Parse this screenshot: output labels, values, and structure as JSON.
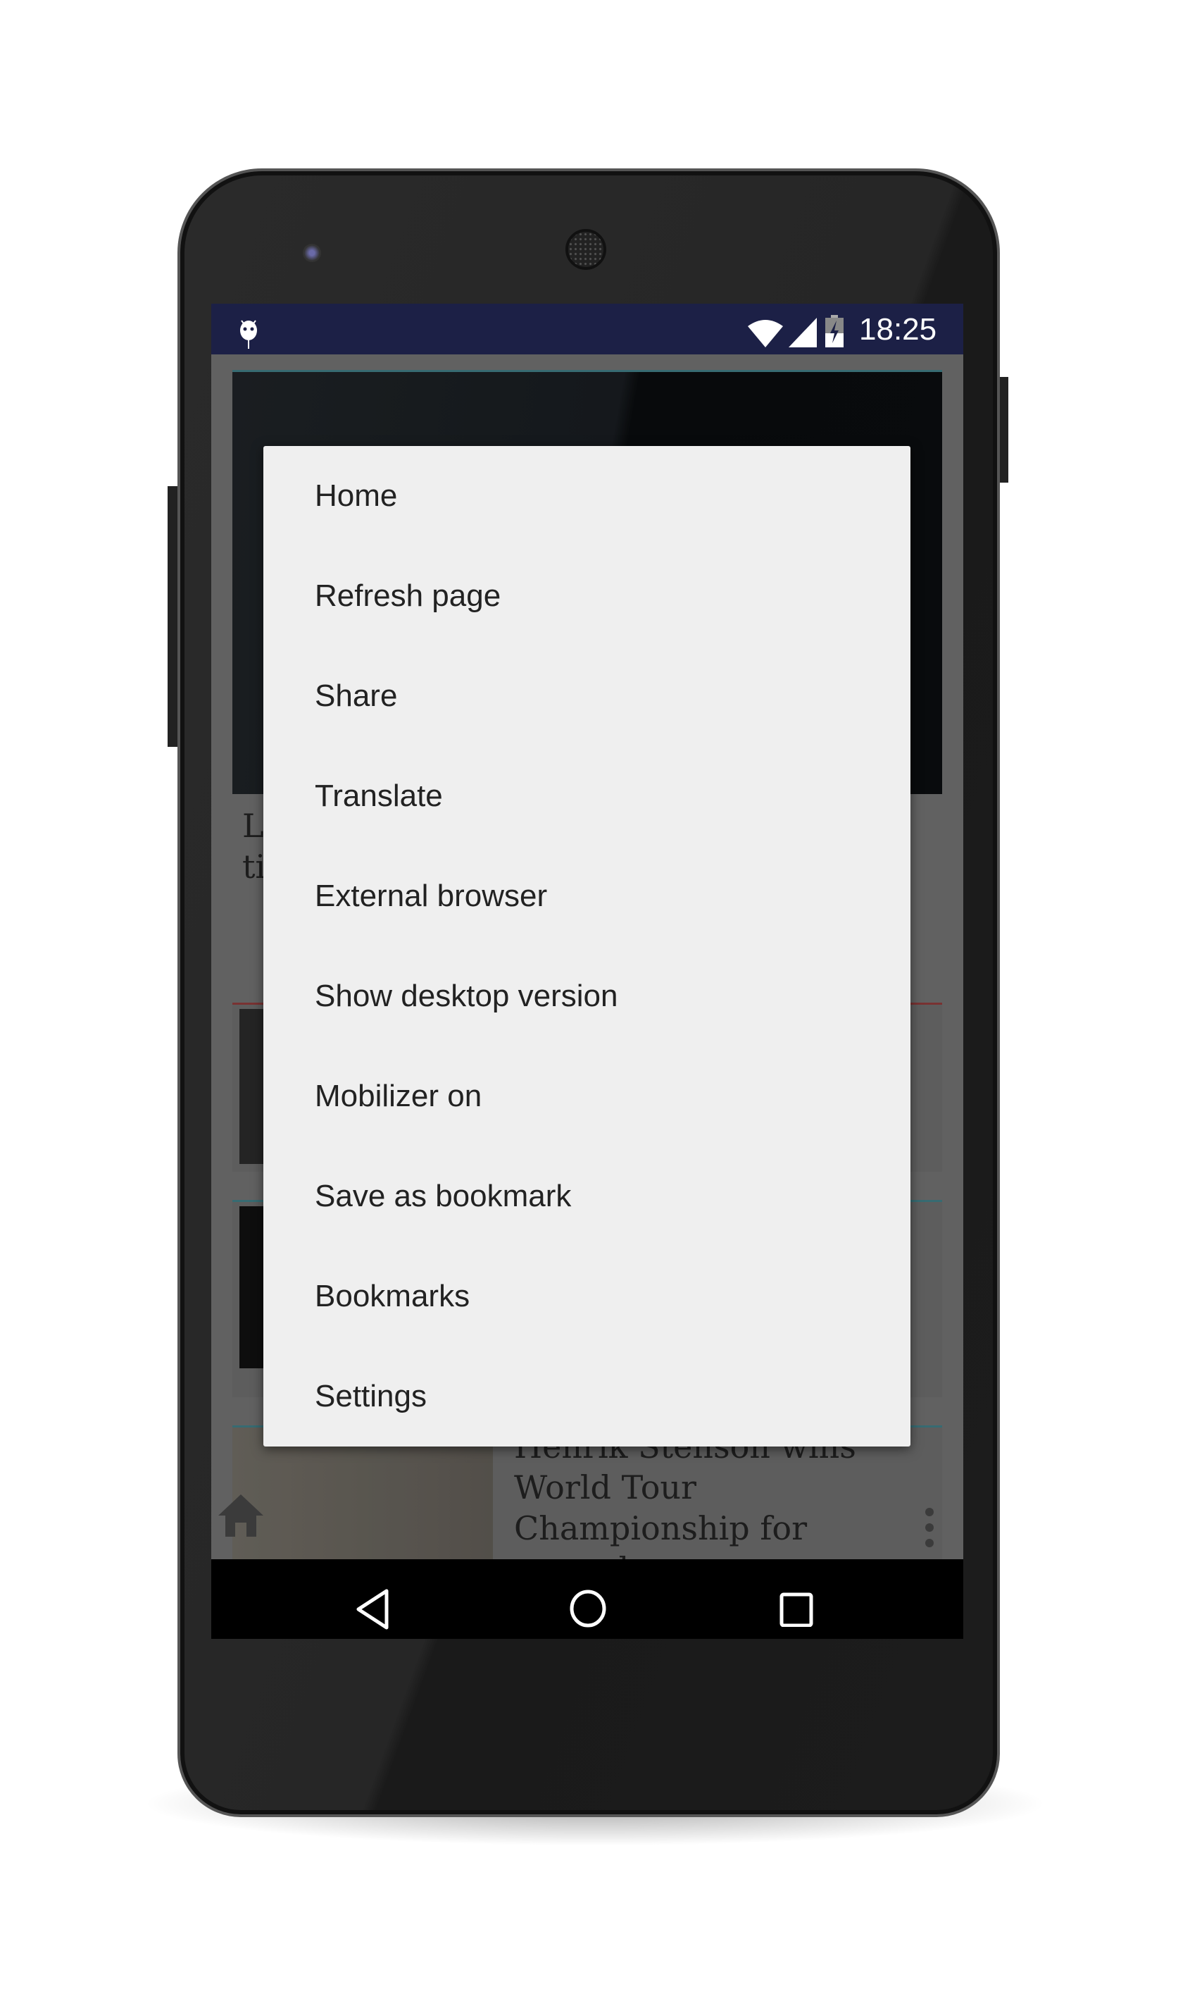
{
  "status_bar": {
    "time": "18:25",
    "icons": [
      "android-debug-icon",
      "wifi-icon",
      "signal-icon",
      "battery-charging-icon"
    ]
  },
  "background_page": {
    "article_partial_line1": "L",
    "article_partial_line2": "ti",
    "bottom_article_title": "Henrik Stenson wins World Tour Championship for second"
  },
  "overflow_menu": {
    "items": [
      {
        "label": "Home"
      },
      {
        "label": "Refresh page"
      },
      {
        "label": "Share"
      },
      {
        "label": "Translate"
      },
      {
        "label": "External browser"
      },
      {
        "label": "Show desktop version"
      },
      {
        "label": "Mobilizer on"
      },
      {
        "label": "Save as bookmark"
      },
      {
        "label": "Bookmarks"
      },
      {
        "label": "Settings"
      }
    ]
  },
  "nav_bar": {
    "buttons": [
      "back",
      "home",
      "recents"
    ]
  },
  "colors": {
    "status_bar": "#1c2046",
    "menu_bg": "#efefef",
    "accent_line": "#3f7a82"
  }
}
